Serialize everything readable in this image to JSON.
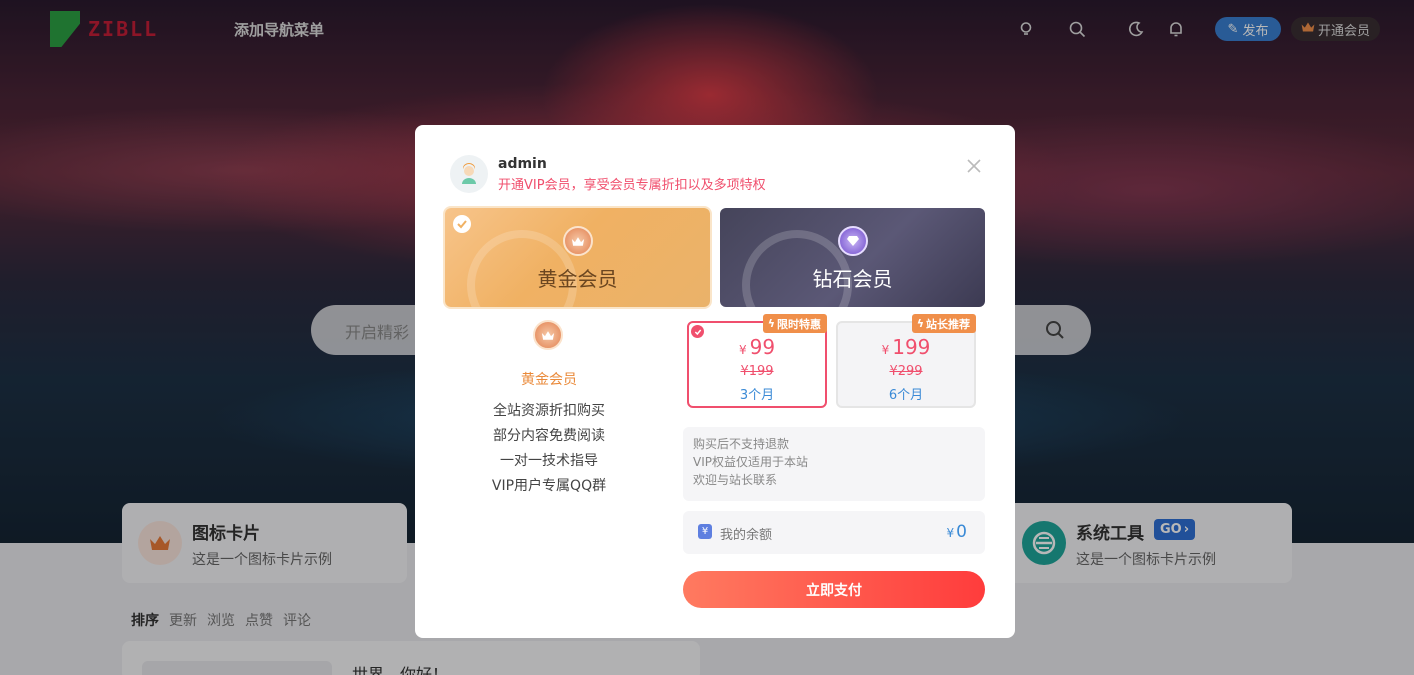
{
  "header": {
    "logo_text": "ZIBLL",
    "nav_add": "添加导航菜单",
    "publish_label": "发布",
    "vip_label": "开通会员"
  },
  "search": {
    "placeholder": "开启精彩"
  },
  "cards": [
    {
      "title": "图标卡片",
      "desc": "这是一个图标卡片示例"
    },
    {
      "title": "系统工具",
      "badge": "GO",
      "desc": "这是一个图标卡片示例"
    }
  ],
  "sortbar": [
    "排序",
    "更新",
    "浏览",
    "点赞",
    "评论"
  ],
  "post": {
    "title": "世界，你好！"
  },
  "modal": {
    "username": "admin",
    "subtitle": "开通VIP会员，享受会员专属折扣以及多项特权",
    "tiers": [
      {
        "name": "黄金会员",
        "selected": true
      },
      {
        "name": "钻石会员",
        "selected": false
      }
    ],
    "selected_tier": {
      "title": "黄金会员",
      "perks": [
        "全站资源折扣购买",
        "部分内容免费阅读",
        "一对一技术指导",
        "VIP用户专属QQ群"
      ]
    },
    "plans": [
      {
        "tag": "限时特惠",
        "currency": "¥",
        "price": "99",
        "original": "¥199",
        "duration": "3个月",
        "selected": true
      },
      {
        "tag": "站长推荐",
        "currency": "¥",
        "price": "199",
        "original": "¥299",
        "duration": "6个月",
        "selected": false
      }
    ],
    "notes": [
      "购买后不支持退款",
      "VIP权益仅适用于本站",
      "欢迎与站长联系"
    ],
    "balance": {
      "label": "我的余额",
      "currency": "¥",
      "value": "0"
    },
    "pay_button": "立即支付"
  },
  "colors": {
    "accent_pink": "#f04f6d",
    "accent_blue": "#3a8ad6",
    "gold": "#f0b163",
    "pay_gradient_start": "#ff7a60",
    "pay_gradient_end": "#ff3c3c"
  }
}
